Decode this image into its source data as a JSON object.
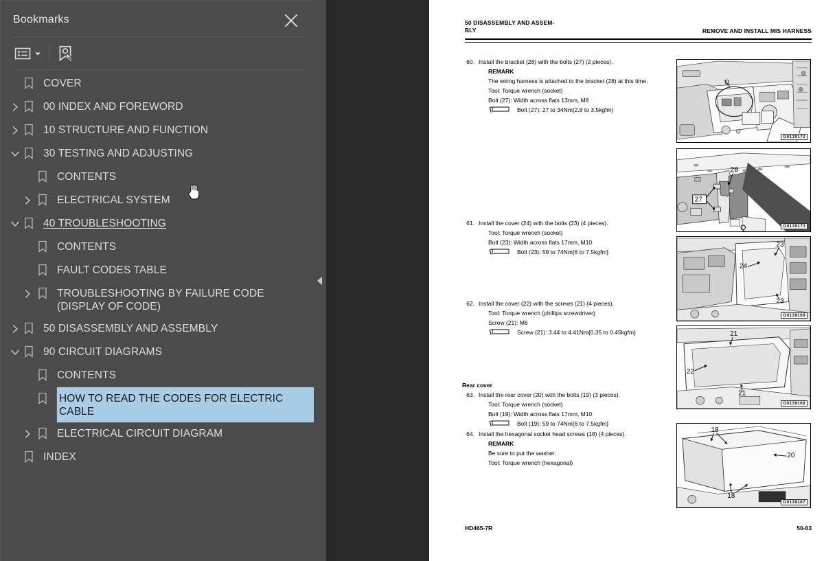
{
  "sidebar": {
    "title": "Bookmarks",
    "close_icon": "close-icon",
    "toolbar": {
      "list_options_icon": "list-options-icon",
      "caret_icon": "chevron-down-icon",
      "new_bookmark_icon": "new-bookmark-icon"
    },
    "items": [
      {
        "label": "COVER",
        "level": 0,
        "twisty": "none"
      },
      {
        "label": "00 INDEX AND FOREWORD",
        "level": 0,
        "twisty": "collapsed"
      },
      {
        "label": "10 STRUCTURE AND FUNCTION",
        "level": 0,
        "twisty": "collapsed"
      },
      {
        "label": "30 TESTING AND ADJUSTING",
        "level": 0,
        "twisty": "expanded"
      },
      {
        "label": "CONTENTS",
        "level": 1,
        "twisty": "none"
      },
      {
        "label": "ELECTRICAL SYSTEM",
        "level": 1,
        "twisty": "collapsed"
      },
      {
        "label": "40 TROUBLESHOOTING",
        "level": 0,
        "twisty": "expanded",
        "underline": true
      },
      {
        "label": "CONTENTS",
        "level": 1,
        "twisty": "none"
      },
      {
        "label": "FAULT CODES TABLE",
        "level": 1,
        "twisty": "none"
      },
      {
        "label": "TROUBLESHOOTING BY FAILURE CODE (DISPLAY OF CODE)",
        "level": 1,
        "twisty": "collapsed"
      },
      {
        "label": "50 DISASSEMBLY AND ASSEMBLY",
        "level": 0,
        "twisty": "collapsed"
      },
      {
        "label": "90 CIRCUIT DIAGRAMS",
        "level": 0,
        "twisty": "expanded"
      },
      {
        "label": "CONTENTS",
        "level": 1,
        "twisty": "none"
      },
      {
        "label": "HOW TO READ THE CODES FOR ELECTRIC CABLE",
        "level": 1,
        "twisty": "none",
        "selected": true
      },
      {
        "label": "ELECTRICAL CIRCUIT DIAGRAM",
        "level": 1,
        "twisty": "collapsed"
      },
      {
        "label": "INDEX",
        "level": 0,
        "twisty": "none"
      }
    ],
    "selection_color": "#a8cde4",
    "panel_color": "#4b4b4b"
  },
  "viewer": {
    "collapse_handle_icon": "collapse-left-icon",
    "background_color": "#282828"
  },
  "document": {
    "header_left": "50 DISASSEMBLY AND ASSEM-BLY",
    "header_left_line1": "50 DISASSEMBLY AND ASSEM-",
    "header_left_line2": "BLY",
    "header_right": "REMOVE AND INSTALL MIS HARNESS",
    "footer_left": "HD465-7R",
    "footer_right": "50-63",
    "steps": [
      {
        "num": "60.",
        "lines": [
          {
            "text": "Install the bracket (28) with the bolts (27) (2 pieces).",
            "style": "normal"
          },
          {
            "text": "REMARK",
            "style": "bold-indent"
          },
          {
            "text": "The wiring harness is attached to the bracket (28) at this time.",
            "style": "indent-just"
          },
          {
            "text": "Tool: Torque wrench (socket)",
            "style": "indent"
          },
          {
            "text": "Bolt (27): Width across flats 13mm, M8",
            "style": "indent"
          },
          {
            "text": "Bolt (27): 27 to 34Nm{2.8 to 3.5kgfm}",
            "style": "torque"
          }
        ]
      },
      {
        "num": "61.",
        "lines": [
          {
            "text": "Install the cover (24) with the bolts (23) (4 pieces).",
            "style": "normal"
          },
          {
            "text": "Tool: Torque wrench (socket)",
            "style": "indent"
          },
          {
            "text": "Bolt (23): Width across flats 17mm, M10",
            "style": "indent"
          },
          {
            "text": "Bolt (23): 59 to 74Nm{6 to 7.5kgfm}",
            "style": "torque"
          }
        ]
      },
      {
        "num": "62.",
        "lines": [
          {
            "text": "Install the cover (22) with the screws (21) (4 pieces).",
            "style": "normal"
          },
          {
            "text": "Tool: Torque wrench (phillips screwdriver)",
            "style": "indent"
          },
          {
            "text": "Screw (21): M6",
            "style": "indent"
          },
          {
            "text": "Screw (21): 3.44 to 4.41Nm{0.35 to 0.45kgfm}",
            "style": "torque"
          }
        ]
      },
      {
        "num": "63.",
        "section": "Rear cover",
        "lines": [
          {
            "text": "Install the rear cover (20) with the bolts (19) (3 pieces).",
            "style": "normal"
          },
          {
            "text": "Tool: Torque wrench (socket)",
            "style": "indent"
          },
          {
            "text": "Bolt (19): Width across flats 17mm, M10",
            "style": "indent"
          },
          {
            "text": "Bolt (19): 59 to 74Nm{6 to 7.5kgfm}",
            "style": "torque"
          }
        ]
      },
      {
        "num": "64.",
        "lines": [
          {
            "text": "Install the hexagonal socket head screws (18) (4 pieces).",
            "style": "normal"
          },
          {
            "text": "REMARK",
            "style": "bold-indent"
          },
          {
            "text": "Be sure to put the washer.",
            "style": "indent"
          },
          {
            "text": "Tool: Torque wrench (hexagonal)",
            "style": "indent"
          }
        ]
      }
    ],
    "figures": [
      {
        "id": "G0139172",
        "callouts": [
          "Q"
        ]
      },
      {
        "id": "G0139173",
        "callouts": [
          "28",
          "27",
          "Q"
        ]
      },
      {
        "id": "G0139169",
        "callouts": [
          "23",
          "24",
          "23"
        ]
      },
      {
        "id": "G0139168",
        "callouts": [
          "21",
          "22",
          "21"
        ]
      },
      {
        "id": "G0139167",
        "callouts": [
          "18",
          "20",
          "18"
        ]
      }
    ]
  }
}
